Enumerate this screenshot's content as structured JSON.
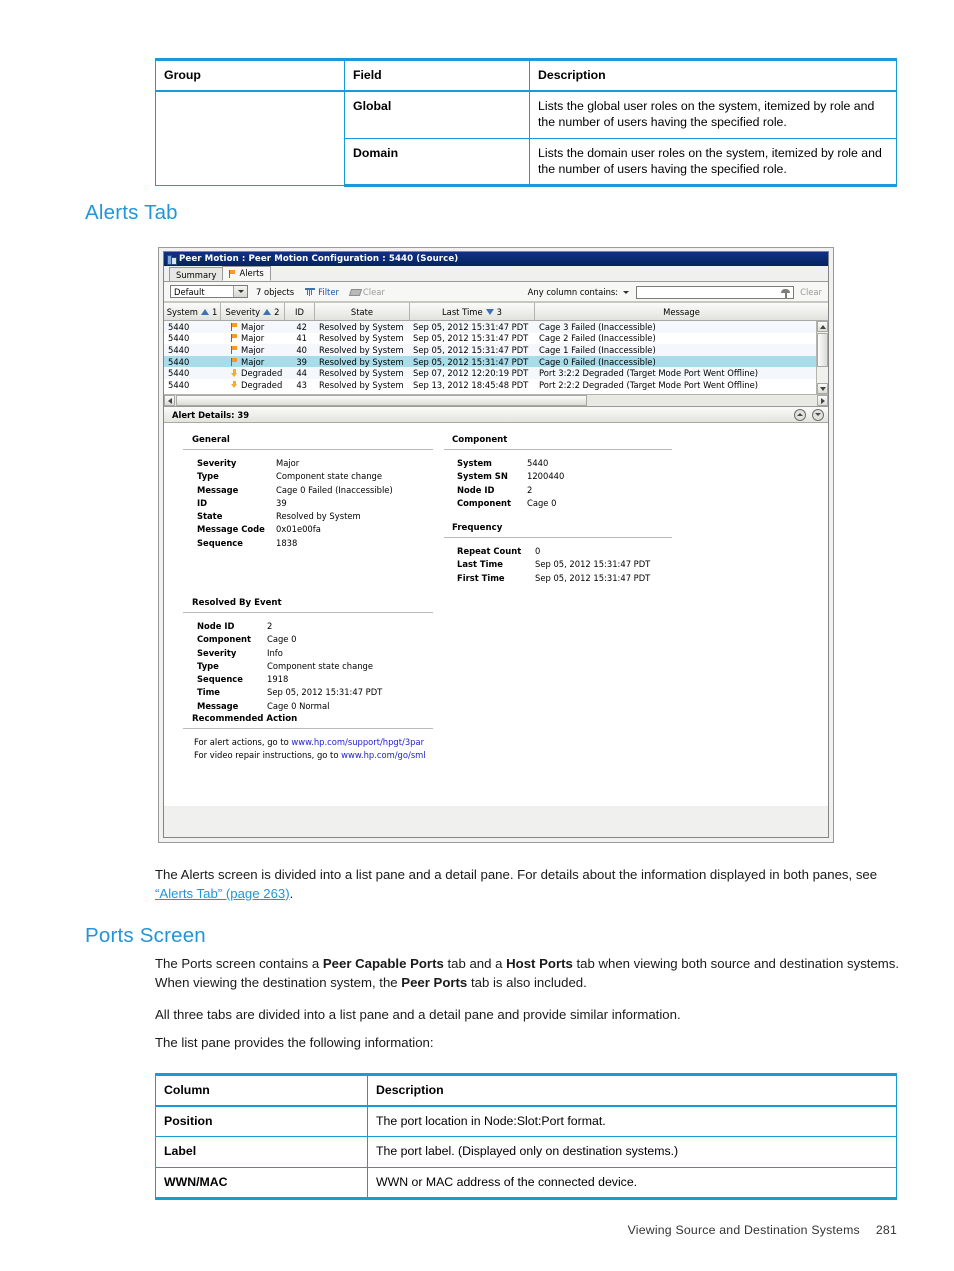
{
  "doc": {
    "table_roles": {
      "headers": [
        "Group",
        "Field",
        "Description"
      ],
      "rows": [
        {
          "group": "",
          "field": "Global",
          "description": "Lists the global user roles on the system, itemized by role and the number of users having the specified role."
        },
        {
          "group": "",
          "field": "Domain",
          "description": "Lists the domain user roles on the system, itemized by role and the number of users having the specified role."
        }
      ]
    },
    "heading_alerts": "Alerts Tab",
    "para_alerts": {
      "before": "The Alerts screen is divided into a list pane and a detail pane. For details about the information displayed in both panes, see ",
      "link": "“Alerts Tab” (page 263)",
      "after": "."
    },
    "heading_ports": "Ports Screen",
    "para_ports_1": {
      "p1": "The Ports screen contains a ",
      "b1": "Peer Capable Ports",
      "p2": " tab and a ",
      "b2": "Host Ports",
      "p3": " tab when viewing both source and destination systems. When viewing the destination system, the ",
      "b3": "Peer Ports",
      "p4": " tab is also included."
    },
    "para_ports_2": "All three tabs are divided into a list pane and a detail pane and provide similar information.",
    "para_ports_3": "The list pane provides the following information:",
    "table_columns": {
      "headers": [
        "Column",
        "Description"
      ],
      "rows": [
        {
          "column": "Position",
          "description": "The port location in Node:Slot:Port format."
        },
        {
          "column": "Label",
          "description": "The port label. (Displayed only on destination systems.)"
        },
        {
          "column": "WWN/MAC",
          "description": "WWN or MAC address of the connected device."
        }
      ]
    },
    "footer": {
      "text": "Viewing Source and Destination Systems",
      "page": "281"
    },
    "colors": {
      "accent": "#1a9bd7",
      "heading": "#2196d6",
      "link": "#2196d6"
    }
  },
  "screenshot": {
    "window_title": "Peer Motion : Peer Motion Configuration : 5440 (Source)",
    "tabs": [
      {
        "label": "Summary",
        "active": false,
        "icon": ""
      },
      {
        "label": "Alerts",
        "active": true,
        "icon": "flag-icon"
      }
    ],
    "toolbar": {
      "view_select_value": "Default",
      "object_count": "7 objects",
      "filter_label": "Filter",
      "clear_label": "Clear",
      "any_column_label": "Any column contains:",
      "search_value": "",
      "search_placeholder": "",
      "clear_right_label": "Clear"
    },
    "grid": {
      "columns": [
        {
          "label": "System",
          "sort": "asc",
          "sort_order": "1"
        },
        {
          "label": "Severity",
          "sort": "asc",
          "sort_order": "2"
        },
        {
          "label": "ID",
          "sort": "",
          "sort_order": ""
        },
        {
          "label": "State",
          "sort": "",
          "sort_order": ""
        },
        {
          "label": "Last Time",
          "sort": "desc",
          "sort_order": "3"
        },
        {
          "label": "Message",
          "sort": "",
          "sort_order": ""
        }
      ],
      "rows": [
        {
          "system": "5440",
          "severity": "Degraded",
          "sev_icon": "degraded",
          "id": "43",
          "state": "Resolved by System",
          "last_time": "Sep 13, 2012 18:45:48 PDT",
          "message": "Port 2:2:2 Degraded (Target Mode Port Went Offline)",
          "selected": false
        },
        {
          "system": "5440",
          "severity": "Degraded",
          "sev_icon": "degraded",
          "id": "44",
          "state": "Resolved by System",
          "last_time": "Sep 07, 2012 12:20:19 PDT",
          "message": "Port 3:2:2 Degraded (Target Mode Port Went Offline)",
          "selected": false
        },
        {
          "system": "5440",
          "severity": "Major",
          "sev_icon": "major",
          "id": "39",
          "state": "Resolved by System",
          "last_time": "Sep 05, 2012 15:31:47 PDT",
          "message": "Cage 0 Failed (Inaccessible)",
          "selected": true
        },
        {
          "system": "5440",
          "severity": "Major",
          "sev_icon": "major",
          "id": "40",
          "state": "Resolved by System",
          "last_time": "Sep 05, 2012 15:31:47 PDT",
          "message": "Cage 1 Failed (Inaccessible)",
          "selected": false
        },
        {
          "system": "5440",
          "severity": "Major",
          "sev_icon": "major",
          "id": "41",
          "state": "Resolved by System",
          "last_time": "Sep 05, 2012 15:31:47 PDT",
          "message": "Cage 2 Failed (Inaccessible)",
          "selected": false
        },
        {
          "system": "5440",
          "severity": "Major",
          "sev_icon": "major",
          "id": "42",
          "state": "Resolved by System",
          "last_time": "Sep 05, 2012 15:31:47 PDT",
          "message": "Cage 3 Failed (Inaccessible)",
          "selected": false
        }
      ]
    },
    "detail": {
      "header": "Alert Details: 39",
      "sections": {
        "general": {
          "title": "General",
          "fields": [
            {
              "k": "Severity",
              "v": "Major"
            },
            {
              "k": "Type",
              "v": "Component state change"
            },
            {
              "k": "Message",
              "v": "Cage 0 Failed (Inaccessible)"
            },
            {
              "k": "ID",
              "v": "39"
            },
            {
              "k": "State",
              "v": "Resolved by System"
            },
            {
              "k": "Message Code",
              "v": "0x01e00fa"
            },
            {
              "k": "Sequence",
              "v": "1838"
            }
          ]
        },
        "component": {
          "title": "Component",
          "fields": [
            {
              "k": "System",
              "v": "5440"
            },
            {
              "k": "System SN",
              "v": "1200440"
            },
            {
              "k": "Node ID",
              "v": "2"
            },
            {
              "k": "Component",
              "v": "Cage 0"
            }
          ]
        },
        "frequency": {
          "title": "Frequency",
          "fields": [
            {
              "k": "Repeat Count",
              "v": "0"
            },
            {
              "k": "Last Time",
              "v": "Sep 05, 2012 15:31:47 PDT"
            },
            {
              "k": "First Time",
              "v": "Sep 05, 2012 15:31:47 PDT"
            }
          ]
        },
        "resolved_by_event": {
          "title": "Resolved By Event",
          "fields": [
            {
              "k": "Node ID",
              "v": "2"
            },
            {
              "k": "Component",
              "v": "Cage 0"
            },
            {
              "k": "Severity",
              "v": "Info"
            },
            {
              "k": "Type",
              "v": "Component state change"
            },
            {
              "k": "Sequence",
              "v": "1918"
            },
            {
              "k": "Time",
              "v": "Sep 05, 2012 15:31:47 PDT"
            },
            {
              "k": "Message",
              "v": "Cage 0 Normal"
            }
          ]
        },
        "recommended_action": {
          "title": "Recommended Action",
          "lines": [
            {
              "text": "For alert actions, go to ",
              "link": "www.hp.com/support/hpgt/3par"
            },
            {
              "text": "For video repair instructions, go to ",
              "link": "www.hp.com/go/sml"
            }
          ]
        }
      }
    }
  }
}
